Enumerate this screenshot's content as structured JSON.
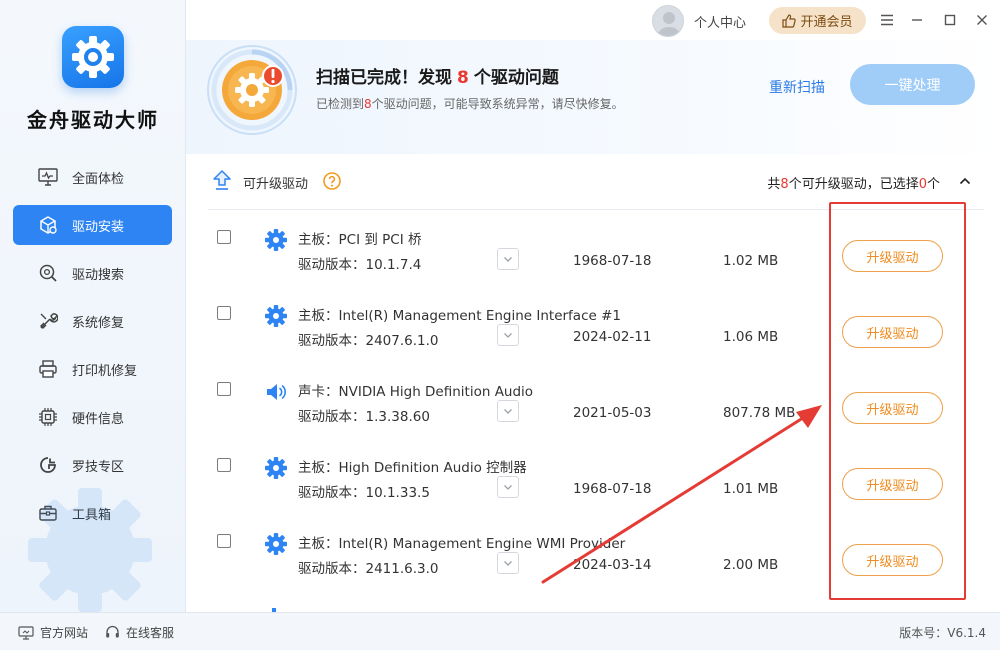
{
  "app": {
    "name": "金舟驱动大师",
    "version": "版本号：V6.1.4"
  },
  "sidebar": {
    "items": [
      {
        "label": "全面体检",
        "icon": "monitor-pulse-icon",
        "active": false
      },
      {
        "label": "驱动安装",
        "icon": "cube-install-icon",
        "active": true
      },
      {
        "label": "驱动搜索",
        "icon": "search-gear-icon",
        "active": false
      },
      {
        "label": "系统修复",
        "icon": "wrench-screwdriver-icon",
        "active": false
      },
      {
        "label": "打印机修复",
        "icon": "printer-icon",
        "active": false
      },
      {
        "label": "硬件信息",
        "icon": "chip-icon",
        "active": false
      },
      {
        "label": "罗技专区",
        "icon": "logitech-icon",
        "active": false
      },
      {
        "label": "工具箱",
        "icon": "toolbox-icon",
        "active": false
      }
    ]
  },
  "topbar": {
    "user_center": "个人中心",
    "vip": "开通会员"
  },
  "header": {
    "title_pre": "扫描已完成！发现",
    "title_num": "8",
    "title_post": "个驱动问题",
    "sub_pre": "已检测到",
    "sub_num": "8",
    "sub_post": "个驱动问题，可能导致系统异常，请尽快修复。",
    "rescan": "重新扫描",
    "one_key": "一键处理"
  },
  "section": {
    "title": "可升级驱动",
    "count_pre": "共",
    "count_num": "8",
    "count_mid": "个可升级驱动，已选择",
    "selected_num": "0",
    "count_post": "个"
  },
  "drivers": [
    {
      "name": "主板：PCI 到 PCI 桥",
      "version": "驱动版本：10.1.7.4",
      "date": "1968-07-18",
      "size": "1.02 MB",
      "button": "升级驱动",
      "icon": "gear-icon"
    },
    {
      "name": "主板：Intel(R) Management Engine Interface #1",
      "version": "驱动版本：2407.6.1.0",
      "date": "2024-02-11",
      "size": "1.06 MB",
      "button": "升级驱动",
      "icon": "gear-icon"
    },
    {
      "name": "声卡：NVIDIA High Definition Audio",
      "version": "驱动版本：1.3.38.60",
      "date": "2021-05-03",
      "size": "807.78 MB",
      "button": "升级驱动",
      "icon": "speaker-icon"
    },
    {
      "name": "主板：High Definition Audio 控制器",
      "version": "驱动版本：10.1.33.5",
      "date": "1968-07-18",
      "size": "1.01 MB",
      "button": "升级驱动",
      "icon": "gear-icon"
    },
    {
      "name": "主板：Intel(R) Management Engine WMI Provider",
      "version": "驱动版本：2411.6.3.0",
      "date": "2024-03-14",
      "size": "2.00 MB",
      "button": "升级驱动",
      "icon": "gear-icon"
    }
  ],
  "footer": {
    "website": "官方网站",
    "support": "在线客服"
  },
  "colors": {
    "accent": "#2d84f2",
    "warn": "#e8382f",
    "orange": "#ef8b1f",
    "annotation": "#e53b35"
  }
}
